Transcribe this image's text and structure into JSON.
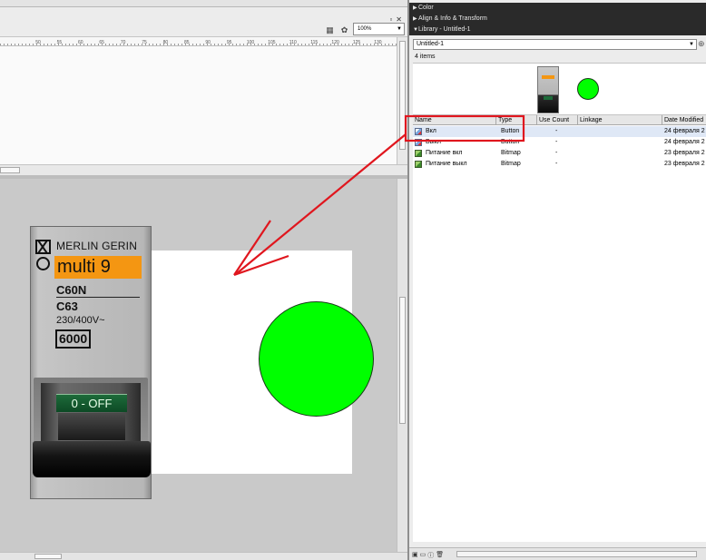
{
  "editor": {
    "zoom": "100%",
    "ruler_ticks": [
      "50",
      "55",
      "60",
      "65",
      "70",
      "75",
      "80",
      "85",
      "90",
      "95",
      "100",
      "105",
      "110",
      "115",
      "120",
      "125",
      "130",
      "13"
    ],
    "window_controls": [
      "_",
      "▫",
      "✕"
    ]
  },
  "breaker": {
    "maker": "MERLIN GERIN",
    "model": "multi 9",
    "type_code": "C60N",
    "rating": "C63",
    "voltage": "230/400V~",
    "capacity": "6000",
    "toggle_label": "0 - OFF"
  },
  "panels": {
    "color": "Color",
    "align": "Align & Info & Transform",
    "library": "Library - Untitled-1"
  },
  "library": {
    "selected_doc": "Untitled-1",
    "item_count": "4 items",
    "columns": [
      "Name",
      "Type",
      "Use Count",
      "Linkage",
      "Date Modified"
    ],
    "rows": [
      {
        "name": "Вкл",
        "type": "Button",
        "use_count": "-",
        "date": "24 февраля 2"
      },
      {
        "name": "Выкл",
        "type": "Button",
        "use_count": "-",
        "date": "24 февраля 2"
      },
      {
        "name": "Питание вкл",
        "type": "Bitmap",
        "use_count": "-",
        "date": "23 февраля 2"
      },
      {
        "name": "Питание выкл",
        "type": "Bitmap",
        "use_count": "-",
        "date": "23 февраля 2"
      }
    ]
  },
  "colors": {
    "annotation": "#e0161e",
    "circle": "#00ff00",
    "model_plate": "#f49612"
  }
}
